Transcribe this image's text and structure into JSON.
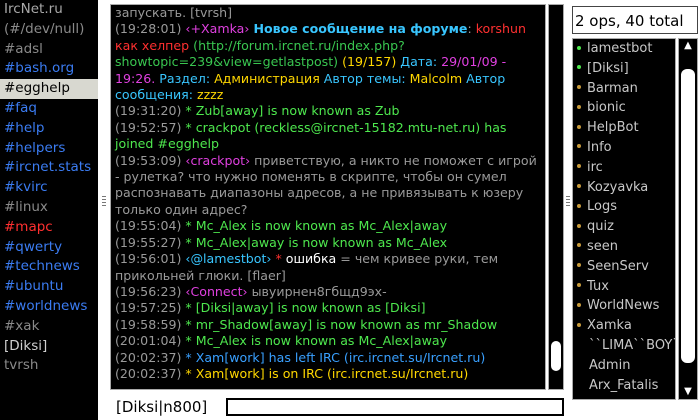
{
  "channels": [
    {
      "label": "IrcNet.ru",
      "color": "#a8a8a8",
      "selected": false
    },
    {
      "label": "(#/dev/null)",
      "color": "#8a8a8a",
      "selected": false
    },
    {
      "label": "#adsl",
      "color": "#8a8a8a",
      "selected": false
    },
    {
      "label": "#bash.org",
      "color": "#3b7cf2",
      "selected": false
    },
    {
      "label": "#egghelp",
      "color": "#000000",
      "selected": true
    },
    {
      "label": "#faq",
      "color": "#3b7cf2",
      "selected": false
    },
    {
      "label": "#help",
      "color": "#3b7cf2",
      "selected": false
    },
    {
      "label": "#helpers",
      "color": "#3b7cf2",
      "selected": false
    },
    {
      "label": "#ircnet.stats",
      "color": "#3b7cf2",
      "selected": false
    },
    {
      "label": "#kvirc",
      "color": "#3b7cf2",
      "selected": false
    },
    {
      "label": "#linux",
      "color": "#8a8a8a",
      "selected": false
    },
    {
      "label": "#mapc",
      "color": "#ff3030",
      "selected": false
    },
    {
      "label": "#qwerty",
      "color": "#3b7cf2",
      "selected": false
    },
    {
      "label": "#technews",
      "color": "#3b7cf2",
      "selected": false
    },
    {
      "label": "#ubuntu",
      "color": "#3b7cf2",
      "selected": false
    },
    {
      "label": "#worldnews",
      "color": "#3b7cf2",
      "selected": false
    },
    {
      "label": "#xak",
      "color": "#8a8a8a",
      "selected": false
    },
    {
      "label": "[Diksi]",
      "color": "#d0d0d0",
      "selected": false
    },
    {
      "label": "tvrsh",
      "color": "#8a8a8a",
      "selected": false
    }
  ],
  "log": [
    [
      {
        "t": "запускать. [tvrsh]",
        "c": "#9a9a9a"
      }
    ],
    [
      {
        "t": "(19:28:01) ",
        "c": "#9a9a9a"
      },
      {
        "t": "‹+Xamka› ",
        "c": "#e040e0"
      },
      {
        "t": "Новое сообщение на форуме",
        "c": "#39c6ff",
        "b": true
      },
      {
        "t": ": ",
        "c": "#9a9a9a"
      },
      {
        "t": "korshun как хелпер",
        "c": "#ff3030"
      },
      {
        "t": " (http://forum.ircnet.ru/index.php?showtopic=239&view=getlastpost) ",
        "c": "#39c650"
      },
      {
        "t": "(19/157)",
        "c": "#ffd700"
      },
      {
        "t": " Дата: ",
        "c": "#39c6ff"
      },
      {
        "t": "29/01/09 - 19:26.",
        "c": "#e040e0"
      },
      {
        "t": " Раздел: ",
        "c": "#39c6ff"
      },
      {
        "t": "Администрация",
        "c": "#ffd700"
      },
      {
        "t": " Автор темы: ",
        "c": "#39c6ff"
      },
      {
        "t": "Malcolm",
        "c": "#ffd700"
      },
      {
        "t": " Автор сообщения: ",
        "c": "#39c6ff"
      },
      {
        "t": "zzzz",
        "c": "#ffd700"
      }
    ],
    [
      {
        "t": "(19:31:20) ",
        "c": "#9a9a9a"
      },
      {
        "t": "* Zub[away] is now known as Zub",
        "c": "#4ee84e"
      }
    ],
    [
      {
        "t": "(19:52:57) ",
        "c": "#9a9a9a"
      },
      {
        "t": "* crackpot (reckless@ircnet-15182.mtu-net.ru) has joined #egghelp",
        "c": "#4ee84e"
      }
    ],
    [
      {
        "t": "(19:53:09) ",
        "c": "#9a9a9a"
      },
      {
        "t": "‹crackpot› ",
        "c": "#e040e0"
      },
      {
        "t": "приветствую, а никто не поможет с игрой - рулетка? что нужно поменять в скрипте, чтобы он сумел распознавать диапазоны адресов, а не привязывать к юзеру только один адрес?",
        "c": "#9a9a9a"
      }
    ],
    [
      {
        "t": "(19:55:04) ",
        "c": "#9a9a9a"
      },
      {
        "t": "* Mc_Alex is now known as Mc_Alex|away",
        "c": "#4ee84e"
      }
    ],
    [
      {
        "t": "(19:55:27) ",
        "c": "#9a9a9a"
      },
      {
        "t": "* Mc_Alex|away is now known as Mc_Alex",
        "c": "#4ee84e"
      }
    ],
    [
      {
        "t": "(19:56:01) ",
        "c": "#9a9a9a"
      },
      {
        "t": "‹@lamestbot› ",
        "c": "#39c6ff"
      },
      {
        "t": "* ",
        "c": "#ff3030"
      },
      {
        "t": "ошибка",
        "c": "#ffffff"
      },
      {
        "t": " = чем кривее руки, тем прикольней глюки. [flaer]",
        "c": "#9a9a9a"
      }
    ],
    [
      {
        "t": "(19:56:23) ",
        "c": "#9a9a9a"
      },
      {
        "t": "‹Connect› ",
        "c": "#e040e0"
      },
      {
        "t": "ывуирнен8гбщд9эх-",
        "c": "#9a9a9a"
      }
    ],
    [
      {
        "t": "(19:57:25) ",
        "c": "#9a9a9a"
      },
      {
        "t": "* [Diksi|away] is now known as [Diksi]",
        "c": "#4ee84e"
      }
    ],
    [
      {
        "t": "(19:58:59) ",
        "c": "#9a9a9a"
      },
      {
        "t": "* mr_Shadow[away] is now known as mr_Shadow",
        "c": "#4ee84e"
      }
    ],
    [
      {
        "t": "(20:01:04) ",
        "c": "#9a9a9a"
      },
      {
        "t": "* Mc_Alex is now known as Mc_Alex|away",
        "c": "#4ee84e"
      }
    ],
    [
      {
        "t": "(20:02:37) ",
        "c": "#9a9a9a"
      },
      {
        "t": "* Xam[work] has left IRC (irc.ircnet.su/Ircnet.ru)",
        "c": "#39a0ff"
      }
    ],
    [
      {
        "t": "(20:02:37) ",
        "c": "#9a9a9a"
      },
      {
        "t": "* Xam[work] is on IRC (irc.ircnet.su/Ircnet.ru)",
        "c": "#ffd700"
      }
    ]
  ],
  "nick_label": "[Diksi|n800]",
  "input": {
    "value": ""
  },
  "ops_summary": "2 ops, 40 total",
  "nicks": [
    {
      "name": "lamestbot",
      "dot": "#4ee84e"
    },
    {
      "name": "[Diksi]",
      "dot": "#4ee84e"
    },
    {
      "name": "Barman",
      "dot": "#c89b3c"
    },
    {
      "name": "bionic",
      "dot": "#c89b3c"
    },
    {
      "name": "HelpBot",
      "dot": "#c89b3c"
    },
    {
      "name": "Info",
      "dot": "#c89b3c"
    },
    {
      "name": "irc",
      "dot": "#c89b3c"
    },
    {
      "name": "Kozyavka",
      "dot": "#c89b3c"
    },
    {
      "name": "Logs",
      "dot": "#c89b3c"
    },
    {
      "name": "quiz",
      "dot": "#c89b3c"
    },
    {
      "name": "seen",
      "dot": "#c89b3c"
    },
    {
      "name": "SeenServ",
      "dot": "#c89b3c"
    },
    {
      "name": "Tux",
      "dot": "#c89b3c"
    },
    {
      "name": "WorldNews",
      "dot": "#c89b3c"
    },
    {
      "name": "Xamka",
      "dot": "#c89b3c"
    },
    {
      "name": "``LIMA``BOY``",
      "dot": ""
    },
    {
      "name": "Admin",
      "dot": ""
    },
    {
      "name": "Arx_Fatalis",
      "dot": ""
    }
  ],
  "icons": {
    "scroll_up": "▲",
    "scroll_down": "▼"
  }
}
